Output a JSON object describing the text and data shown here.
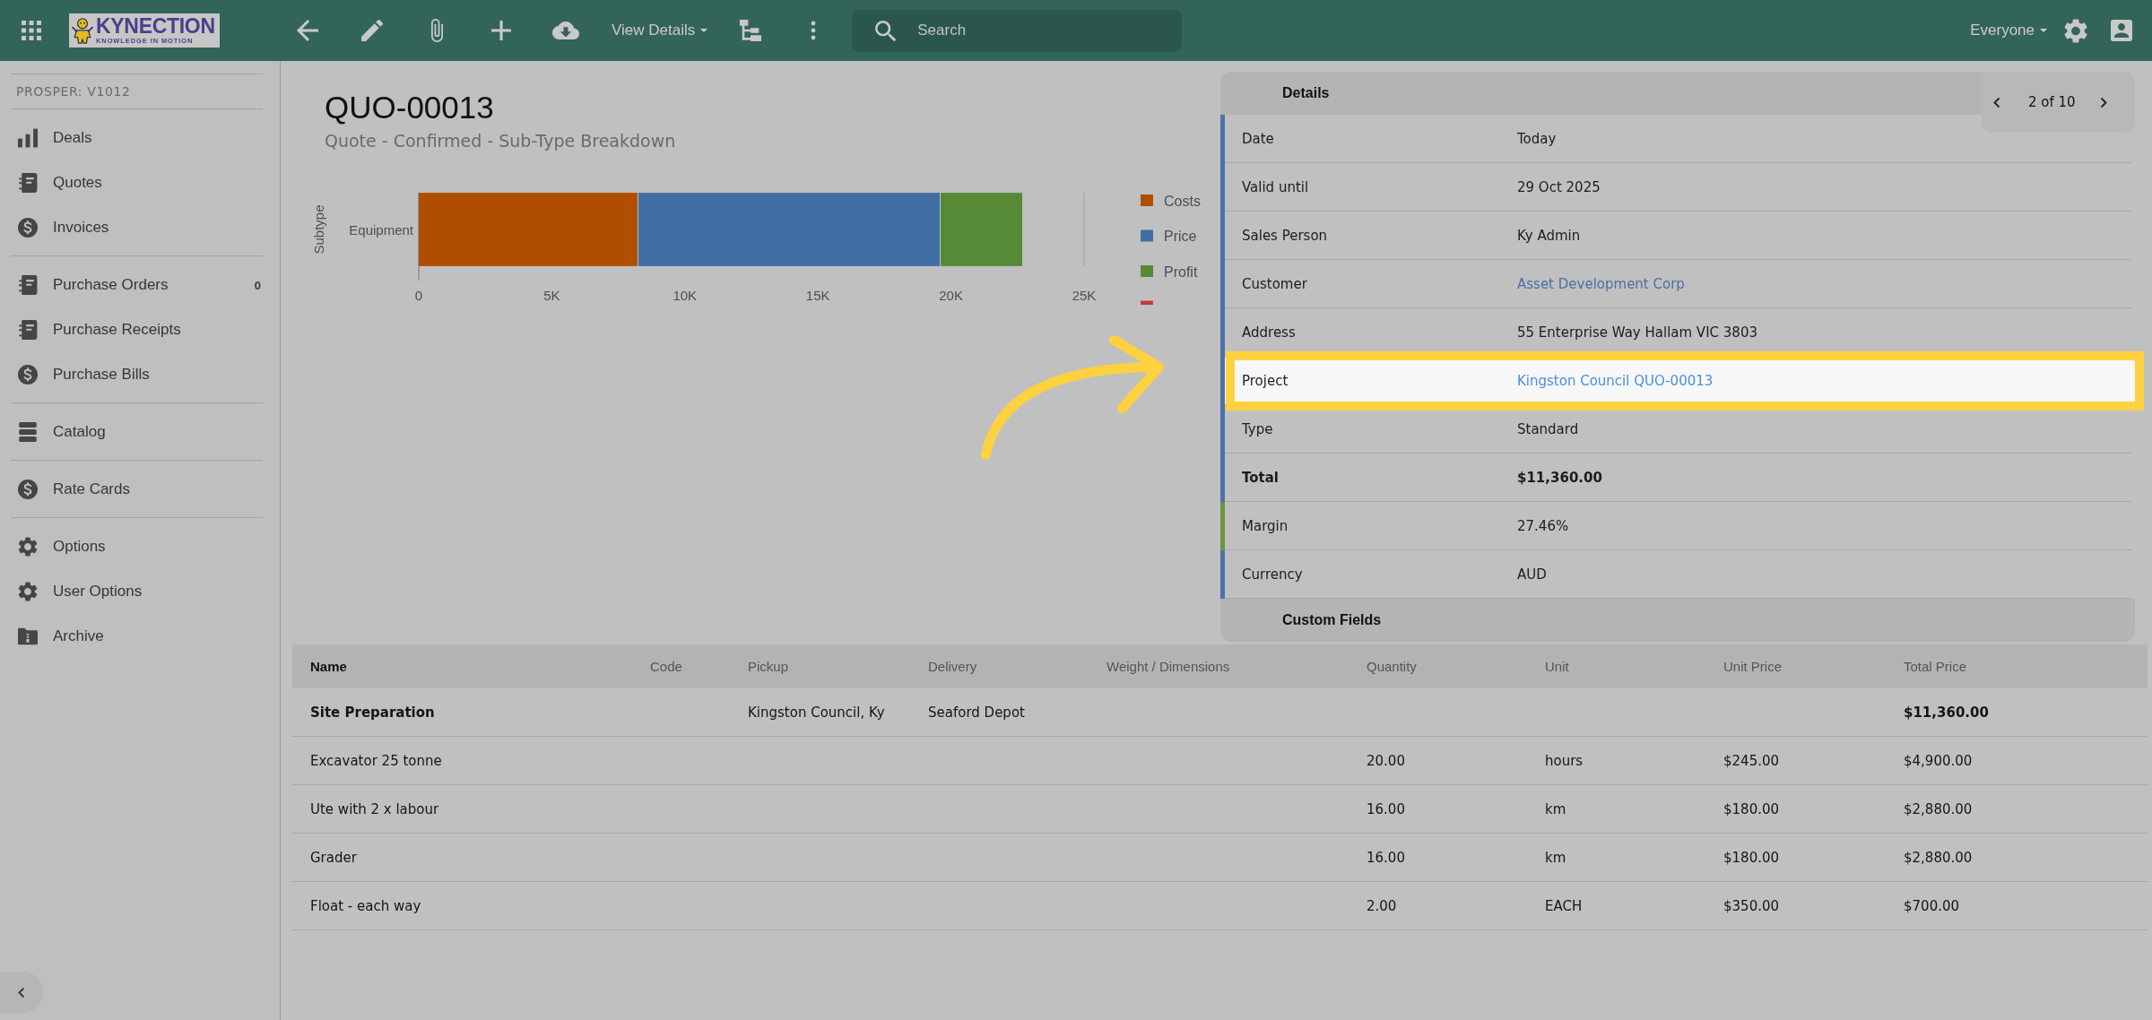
{
  "top_bar": {
    "logo": {
      "wordmark": "KYNECTION",
      "tagline": "KNOWLEDGE IN MOTION"
    },
    "view_menu": "View Details",
    "search": {
      "placeholder": "Search"
    },
    "audience_menu": "Everyone"
  },
  "sidebar": {
    "heading": "PROSPER: V1012",
    "sections": [
      {
        "items": [
          {
            "label": "Deals",
            "selected": false
          },
          {
            "label": "Quotes",
            "selected": false
          },
          {
            "label": "Invoices",
            "selected": false
          }
        ]
      },
      {
        "items": [
          {
            "label": "Purchase Orders",
            "count": "0",
            "selected": false
          },
          {
            "label": "Purchase Receipts",
            "selected": false
          },
          {
            "label": "Purchase Bills",
            "selected": false
          }
        ]
      },
      {
        "items": [
          {
            "label": "Catalog",
            "selected": false
          }
        ]
      },
      {
        "items": [
          {
            "label": "Rate Cards",
            "selected": false
          }
        ]
      },
      {
        "items": [
          {
            "label": "Options",
            "selected": false
          },
          {
            "label": "User Options",
            "selected": false
          },
          {
            "label": "Archive",
            "selected": false
          }
        ]
      }
    ]
  },
  "page": {
    "title": "QUO-00013",
    "subtitle": "Quote - Confirmed - Sub-Type Breakdown",
    "chart_data": {
      "type": "bar",
      "orientation": "horizontal",
      "stacked": true,
      "legend": "right",
      "ylabel": "Subtype",
      "categories": [
        "Equipment"
      ],
      "series": [
        {
          "name": "Costs",
          "color": "#b04e00",
          "values": [
            8250
          ]
        },
        {
          "name": "Price",
          "color": "#416fa3",
          "values": [
            11360
          ]
        },
        {
          "name": "Profit",
          "color": "#578a36",
          "values": [
            3100
          ]
        },
        {
          "color": "#c13c3c",
          "values": [
            null
          ]
        }
      ],
      "xlim": [
        0,
        25000
      ],
      "xticks": [
        0,
        {
          "value": 5000,
          "label": "5K"
        },
        {
          "value": 10000,
          "label": "10K"
        },
        {
          "value": 15000,
          "label": "15K"
        },
        {
          "value": 20000,
          "label": "20K"
        },
        {
          "value": 25000,
          "label": "25K"
        }
      ]
    }
  },
  "details": {
    "title": "Details",
    "pager": "2 of 10",
    "rows": [
      {
        "label": "Date",
        "value": "Today",
        "kind": "text",
        "color": "#4a73a8",
        "highlighted": false
      },
      {
        "label": "Valid until",
        "value": "29 Oct 2025",
        "kind": "text",
        "color": "#4a73a8",
        "highlighted": false
      },
      {
        "label": "Sales Person",
        "value": "Ky Admin",
        "kind": "text",
        "color": "#4a73a8",
        "highlighted": false
      },
      {
        "label": "Customer",
        "value": "Asset Development Corp",
        "kind": "link",
        "color": "#4a73a8",
        "highlighted": false
      },
      {
        "label": "Address",
        "value": "55 Enterprise Way Hallam VIC 3803",
        "kind": "text",
        "color": "#4a73a8",
        "highlighted": false
      },
      {
        "label": "Project",
        "value": "Kingston Council QUO-00013",
        "kind": "link",
        "color": "#4a73a8",
        "highlighted": true
      },
      {
        "label": "Type",
        "value": "Standard",
        "kind": "text",
        "color": "#4a73a8",
        "highlighted": false
      },
      {
        "label": "Total",
        "value": "$11,360.00",
        "kind": "total",
        "color": "#4a73a8",
        "highlighted": false
      },
      {
        "label": "Margin",
        "value": "27.46%",
        "kind": "text",
        "color": "#6b973a",
        "highlighted": false
      },
      {
        "label": "Currency",
        "value": "AUD",
        "kind": "text",
        "color": "#4a73a8",
        "highlighted": false
      }
    ]
  },
  "custom_fields": {
    "title": "Custom Fields"
  },
  "table": {
    "columns": [
      "Name",
      "Code",
      "Pickup",
      "Delivery",
      "Weight / Dimensions",
      "Quantity",
      "Unit",
      "Unit Price",
      "Total Price"
    ],
    "rows": [
      {
        "kind": "group",
        "name": "Site Preparation",
        "pickup": "Kingston Council, Ky",
        "delivery": "Seaford Depot",
        "total_price": "$11,360.00"
      },
      {
        "kind": "item",
        "name": "Excavator 25 tonne",
        "quantity": "20.00",
        "unit": "hours",
        "unit_price": "$245.00",
        "total_price": "$4,900.00"
      },
      {
        "kind": "item",
        "name": "Ute with 2 x labour",
        "quantity": "16.00",
        "unit": "km",
        "unit_price": "$180.00",
        "total_price": "$2,880.00"
      },
      {
        "kind": "item",
        "name": "Grader",
        "quantity": "16.00",
        "unit": "km",
        "unit_price": "$180.00",
        "total_price": "$2,880.00"
      },
      {
        "kind": "item",
        "name": "Float - each way",
        "quantity": "2.00",
        "unit": "EACH",
        "unit_price": "$350.00",
        "total_price": "$700.00"
      }
    ]
  }
}
